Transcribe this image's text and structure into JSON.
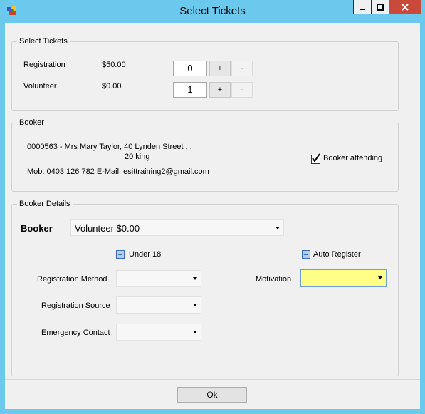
{
  "window": {
    "title": "Select Tickets"
  },
  "select_tickets": {
    "legend": "Select Tickets",
    "rows": [
      {
        "name": "Registration",
        "price": "$50.00",
        "qty": "0",
        "plus": "+",
        "minus": "-"
      },
      {
        "name": "Volunteer",
        "price": "$0.00",
        "qty": "1",
        "plus": "+",
        "minus": "-"
      }
    ]
  },
  "booker": {
    "legend": "Booker",
    "line1": "0000563 - Mrs Mary Taylor,  40 Lynden Street , ,",
    "line2": "20 king",
    "line3": "Mob: 0403 126 782 E-Mail: esittraining2@gmail.com",
    "attending_label": "Booker attending",
    "attending_checked": true
  },
  "booker_details": {
    "legend": "Booker Details",
    "booker_label": "Booker",
    "booker_value": "Volunteer $0.00",
    "under18_label": "Under 18",
    "auto_register_label": "Auto Register",
    "registration_method_label": "Registration Method",
    "registration_source_label": "Registration Source",
    "emergency_contact_label": "Emergency Contact",
    "motivation_label": "Motivation",
    "highlight_color": "#ffff88"
  },
  "footer": {
    "ok_label": "Ok"
  }
}
